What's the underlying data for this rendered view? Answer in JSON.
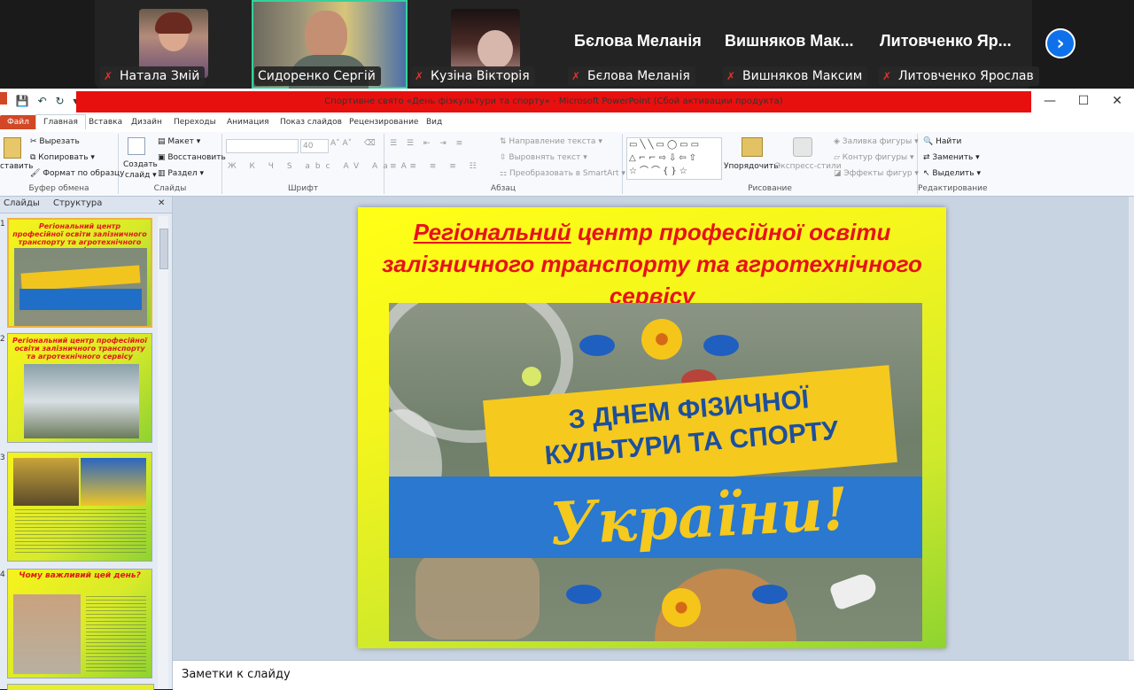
{
  "zoom": {
    "participants": [
      {
        "name": "Натала Змій",
        "muted": true
      },
      {
        "name": "Сидоренко Сергій",
        "muted": false,
        "active": true
      },
      {
        "name": "Кузіна Вікторія",
        "muted": true
      },
      {
        "name": "Бєлова Меланія",
        "muted": true,
        "big_label": "Бєлова Меланія"
      },
      {
        "name": "Вишняков Максим",
        "muted": true,
        "big_label": "Вишняков Мак..."
      },
      {
        "name": "Литовченко Ярослав",
        "muted": true,
        "big_label": "Литовченко Яр..."
      }
    ],
    "next_icon": "chevron-right-icon",
    "next_symbol": "›",
    "mic_symbol": "✗"
  },
  "window": {
    "title": "Спортивне свято «День фізкультури та спорту» - Microsoft PowerPoint (Сбой активации продукта)",
    "controls": {
      "minimize": "—",
      "maximize": "☐",
      "close": "✕"
    }
  },
  "qat": {
    "save": "💾",
    "undo": "↶",
    "redo": "↻",
    "more": "▾"
  },
  "tabs": [
    "Файл",
    "Главная",
    "Вставка",
    "Дизайн",
    "Переходы",
    "Анимация",
    "Показ слайдов",
    "Рецензирование",
    "Вид"
  ],
  "ribbon": {
    "clipboard": {
      "label": "Буфер обмена",
      "paste": "ставить",
      "cut": "Вырезать",
      "copy": "Копировать",
      "format": "Формат по образцу"
    },
    "slides": {
      "label": "Слайды",
      "create": "Создать",
      "create2": "слайд",
      "layout": "Макет",
      "reset": "Восстановить",
      "section": "Раздел"
    },
    "font": {
      "label": "Шрифт",
      "size": "40"
    },
    "paragraph": {
      "label": "Абзац",
      "text_direction": "Направление текста",
      "align_text": "Выровнять текст",
      "smartart": "Преобразовать в SmartArt"
    },
    "drawing": {
      "label": "Рисование",
      "arrange": "Упорядочить",
      "quick_styles": "Экспресс-стили",
      "fill": "Заливка фигуры",
      "outline": "Контур фигуры",
      "effects": "Эффекты фигур"
    },
    "editing": {
      "label": "Редактирование",
      "find": "Найти",
      "replace": "Заменить",
      "select": "Выделить"
    }
  },
  "left_panel": {
    "tab_slides": "Слайды",
    "tab_outline": "Структура",
    "close": "✕",
    "thumbs": [
      {
        "num": "1",
        "title": "Регіональний центр професійної освіти залізничного транспорту та агротехнічного сервісу"
      },
      {
        "num": "2",
        "title": "Регіональний центр професійної освіти залізничного транспорту та агротехнічного сервісу"
      },
      {
        "num": "3",
        "title": ""
      },
      {
        "num": "4",
        "title": "Чому важливий цей день?"
      }
    ]
  },
  "slide": {
    "title_part1": "Регіональний",
    "title_part2": " центр професійної освіти залізничного транспорту та агротехнічного сервісу",
    "banner_line1": "З ДНЕМ ФІЗИЧНОЇ",
    "banner_line2": "КУЛЬТУРИ ТА СПОРТУ",
    "banner_script": "України!"
  },
  "notes": {
    "placeholder": "Заметки к слайду"
  }
}
